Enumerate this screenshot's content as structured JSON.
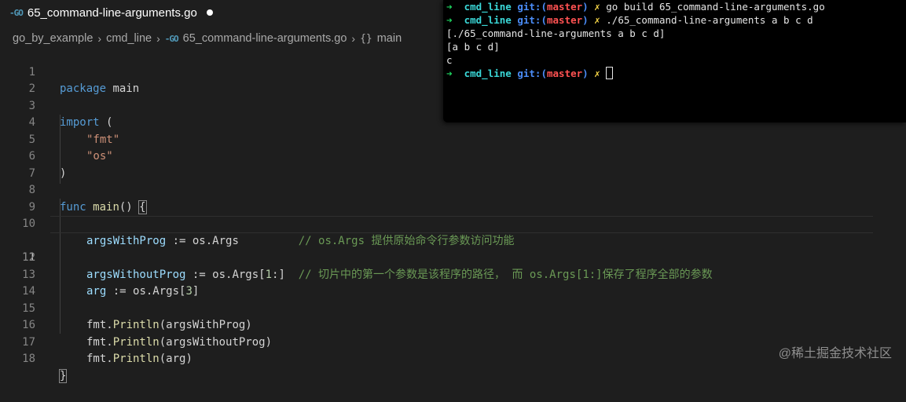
{
  "tab": {
    "icon": "go-file-icon",
    "icon_text": "-GO",
    "title": "65_command-line-arguments.go"
  },
  "breadcrumb": {
    "items": [
      "go_by_example",
      "cmd_line",
      "65_command-line-arguments.go",
      "main"
    ],
    "file_icon_text": "-GO",
    "symbol_icon_text": "{}"
  },
  "editor": {
    "active_line": 11,
    "line_numbers": [
      "1",
      "2",
      "3",
      "4",
      "5",
      "6",
      "7",
      "8",
      "9",
      "10",
      "11",
      "12",
      "13",
      "14",
      "15",
      "16",
      "17",
      "18"
    ],
    "tokens": {
      "l1_kw": "package",
      "l1_name": " main",
      "l3_kw": "import",
      "l3_paren": " (",
      "l4_str": "\"fmt\"",
      "l5_str": "\"os\"",
      "l6_paren": ")",
      "l8_kw": "func",
      "l8_fn": "main",
      "l8_parens": "() ",
      "l8_brace": "{",
      "l10_var": "argsWithProg",
      "l10_op": " := os.Args         ",
      "l10_cmt": "// os.Args 提供原始命令行参数访问功能",
      "l11_var": "argsWithoutProg",
      "l11_op": " := os.Args[",
      "l11_num": "1",
      "l11_rest": ":]  ",
      "l11_cmt": "// 切片中的第一个参数是该程序的路径， 而 os.Args[1:]保存了程序全部的参数",
      "l13_var": "arg",
      "l13_op": " := os.Args[",
      "l13_num": "3",
      "l13_close": "]",
      "l15_pkg": "fmt.",
      "l15_fn": "Println",
      "l15_args": "(argsWithProg)",
      "l16_pkg": "fmt.",
      "l16_fn": "Println",
      "l16_args": "(argsWithoutProg)",
      "l17_pkg": "fmt.",
      "l17_fn": "Println",
      "l17_args": "(arg)",
      "l18_brace": "}"
    }
  },
  "terminal": {
    "prompt_arrow": "➜",
    "dir": "cmd_line",
    "git_label": "git:(",
    "branch": "master",
    "git_close": ")",
    "dirty_mark": "✗",
    "commands": [
      "go build 65_command-line-arguments.go",
      "./65_command-line-arguments a b c d"
    ],
    "outputs": [
      "[./65_command-line-arguments a b c d]",
      "[a b c d]",
      "c"
    ]
  },
  "watermark": "@稀土掘金技术社区",
  "colors": {
    "editor_bg": "#1e1e1e",
    "keyword": "#569cd6",
    "string": "#ce9178",
    "function": "#dcdcaa",
    "variable": "#9cdcfe",
    "number": "#b5cea8",
    "comment": "#6a9955",
    "terminal_bg": "#000000",
    "terminal_arrow": "#1ed760",
    "terminal_dir": "#3ad7d7",
    "terminal_branch": "#ff5252"
  }
}
